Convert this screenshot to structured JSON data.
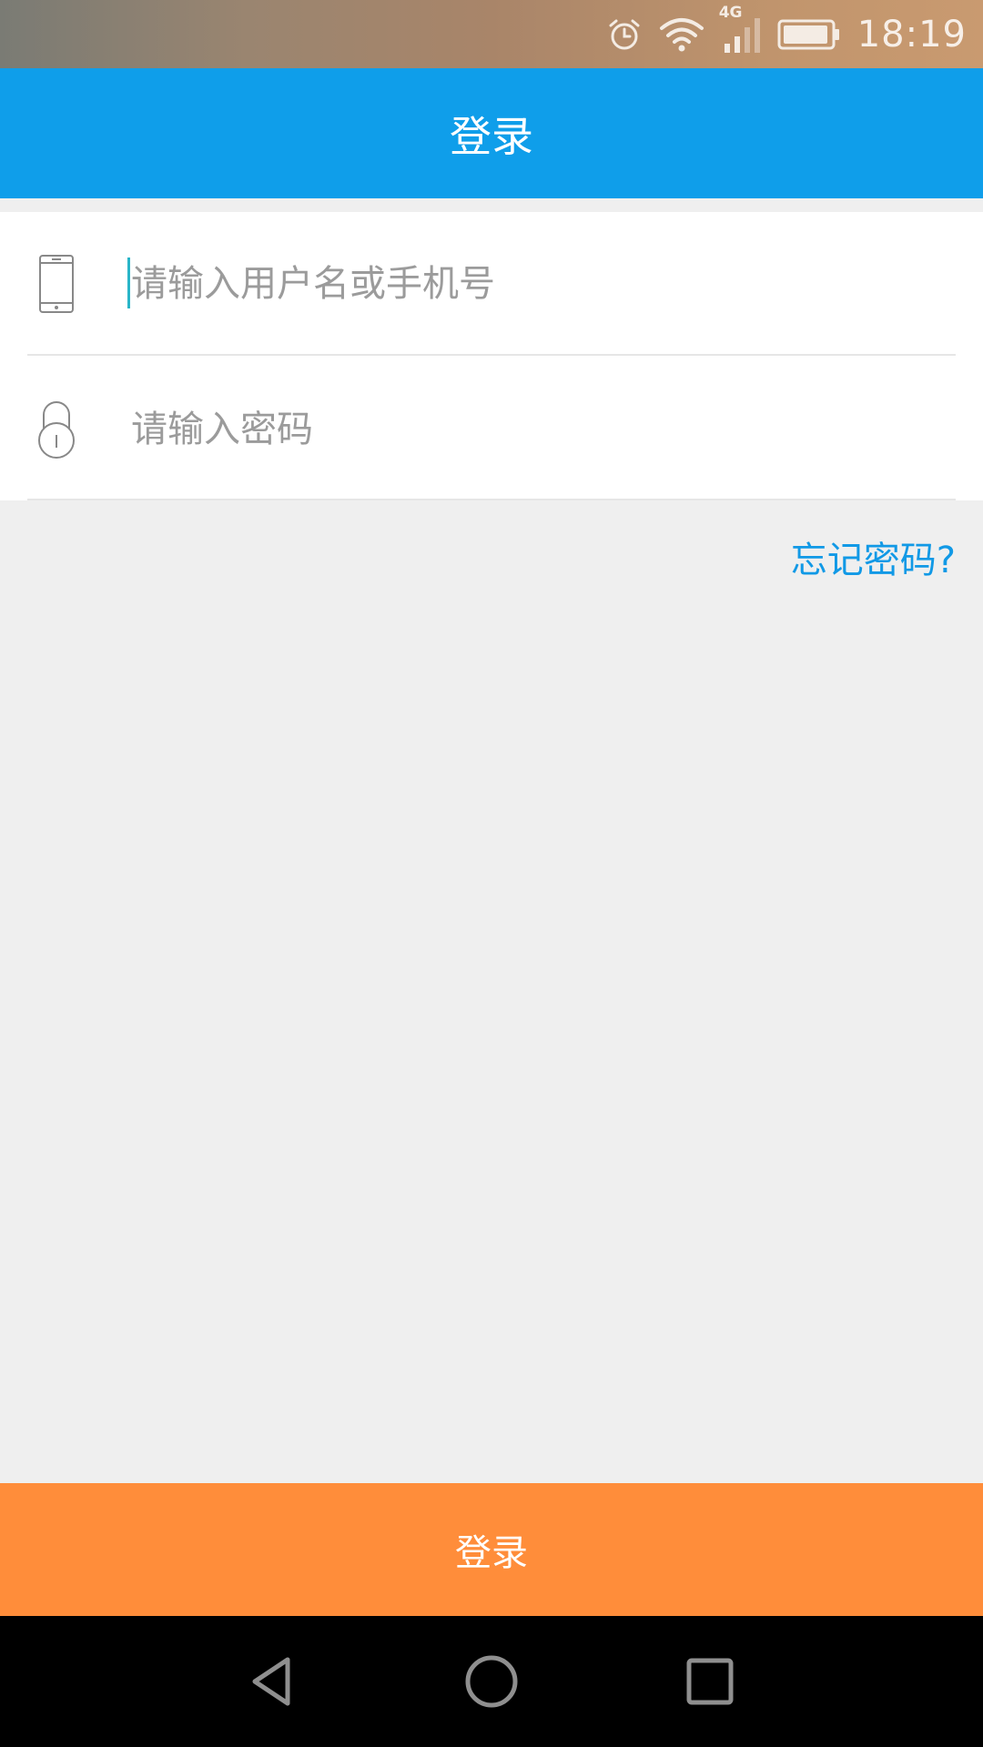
{
  "status_bar": {
    "time": "18:19",
    "network": "4G",
    "icons": [
      "alarm-icon",
      "wifi-icon",
      "signal-icon",
      "battery-icon"
    ]
  },
  "header": {
    "title": "登录"
  },
  "form": {
    "username_placeholder": "请输入用户名或手机号",
    "password_placeholder": "请输入密码",
    "username_icon": "phone-icon",
    "password_icon": "lock-icon"
  },
  "forgot_password_label": "忘记密码?",
  "login_button_label": "登录",
  "nav": {
    "icons": [
      "back-icon",
      "home-icon",
      "recent-apps-icon"
    ]
  },
  "colors": {
    "header_bg": "#0f9eea",
    "accent_link": "#1199e6",
    "login_button_bg": "#ff8d3a",
    "page_bg": "#efefef"
  }
}
